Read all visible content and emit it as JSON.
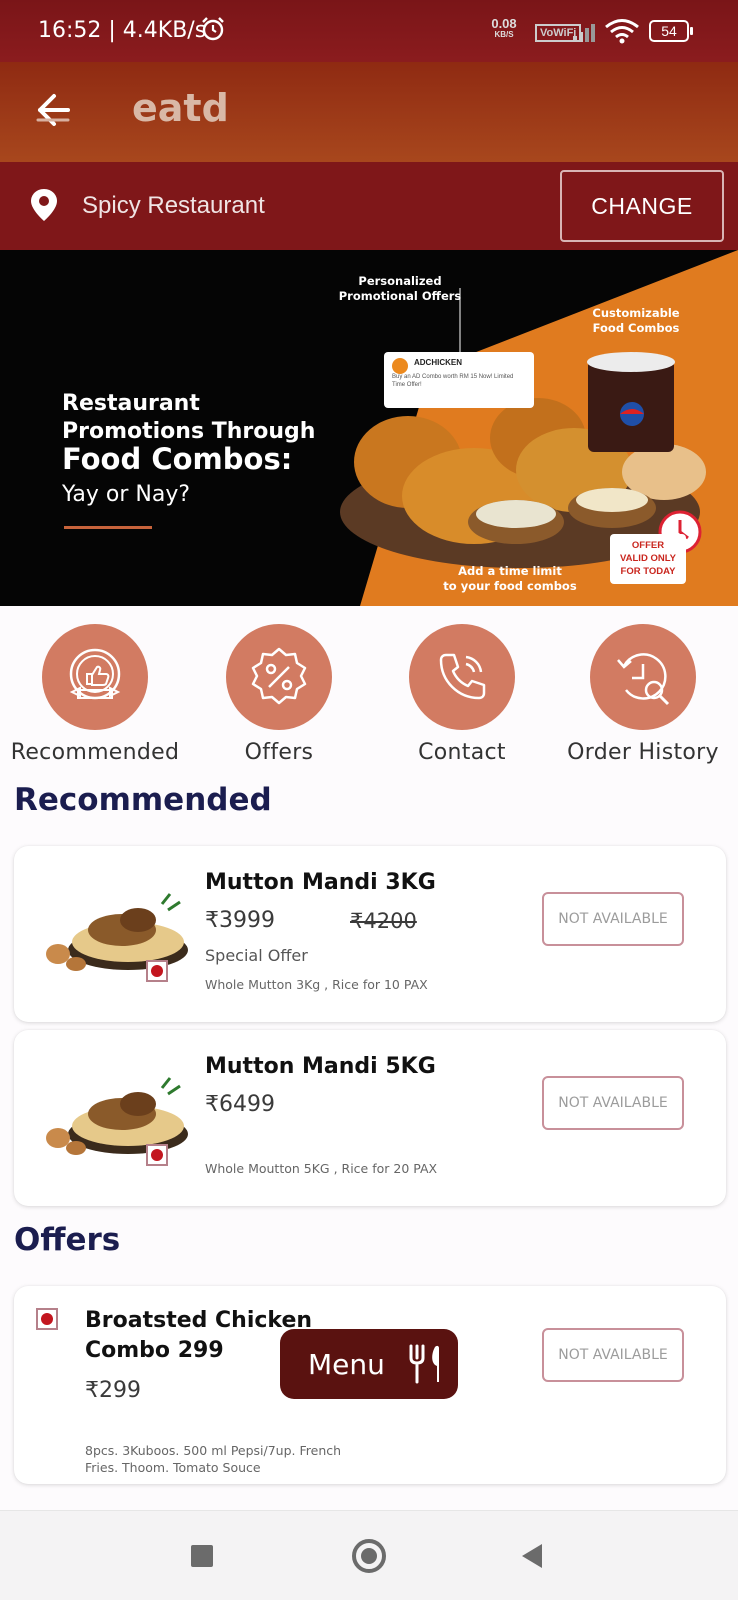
{
  "status_bar": {
    "time_speed": "16:52 | 4.4KB/s",
    "net_speed_value": "0.08",
    "net_speed_unit": "KB/S",
    "network_label": "VoWiFi",
    "battery": "54"
  },
  "app_bar": {
    "title": "eatd"
  },
  "location": {
    "name": "Spicy Restaurant",
    "change_label": "CHANGE"
  },
  "banner": {
    "headline_1": "Restaurant",
    "headline_2": "Promotions Through",
    "headline_3": "Food Combos:",
    "headline_4": "Yay or Nay?",
    "callout_1": "Personalized\nPromotional Offers",
    "callout_2": "Customizable\nFood Combos",
    "callout_3": "Add a time limit\nto your food combos",
    "popup_title": "ADCHICKEN",
    "popup_text": "Buy an AD Combo worth RM 15 Now! Limited Time Offer!",
    "offer_badge": "OFFER\nVALID ONLY\nFOR TODAY",
    "cup_brand": "pepsi"
  },
  "quick_actions": [
    {
      "label": "Recommended",
      "icon": "thumbs-up-badge-icon"
    },
    {
      "label": "Offers",
      "icon": "percent-badge-icon"
    },
    {
      "label": "Contact",
      "icon": "phone-icon"
    },
    {
      "label": "Order History",
      "icon": "history-search-icon"
    }
  ],
  "sections": {
    "recommended": "Recommended",
    "offers": "Offers"
  },
  "recommended_items": [
    {
      "name": "Mutton Mandi 3KG",
      "price": "₹3999",
      "old_price": "₹4200",
      "tag": "Special Offer",
      "description": "Whole Mutton 3Kg , Rice for 10 PAX",
      "status": "NOT AVAILABLE"
    },
    {
      "name": "Mutton Mandi 5KG",
      "price": "₹6499",
      "description": "Whole Moutton 5KG , Rice for 20 PAX",
      "status": "NOT AVAILABLE"
    }
  ],
  "offer_items": [
    {
      "name_line_1": "Broatsted Chicken",
      "name_line_2": "Combo 299",
      "price": "₹299",
      "description_line_1": "8pcs. 3Kuboos. 500 ml Pepsi/7up. French",
      "description_line_2": "Fries. Thoom. Tomato Souce",
      "status": "NOT AVAILABLE"
    }
  ],
  "menu_button": {
    "label": "Menu"
  },
  "colors": {
    "status_bar": "#7a1518",
    "app_bar": "#a8471d",
    "location_bar": "#7f1719",
    "accent": "#d27b62",
    "section_title": "#1b1d4f",
    "menu_button": "#5a1210",
    "veg_dot": "#c3161f"
  }
}
